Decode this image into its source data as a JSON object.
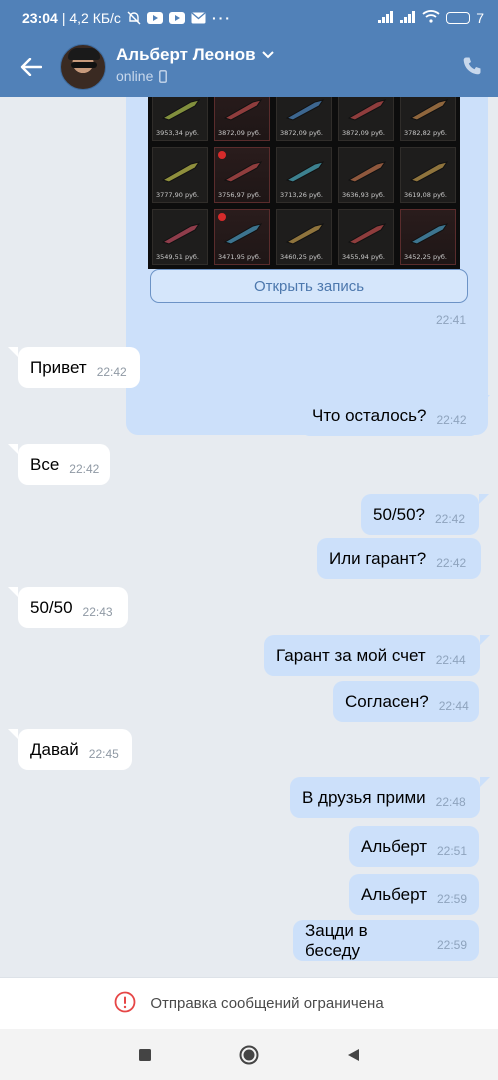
{
  "status_bar": {
    "time": "23:04",
    "net_speed": "| 4,2 КБ/с",
    "battery": "7"
  },
  "header": {
    "contact_name": "Альберт Леонов",
    "status": "online"
  },
  "record": {
    "prices": [
      "3953,34 руб.",
      "3872,09 руб.",
      "3872,09 руб.",
      "3872,09 руб.",
      "3782,82 руб.",
      "3777,90 руб.",
      "3756,97 руб.",
      "3713,26 руб.",
      "3636,93 руб.",
      "3619,08 руб.",
      "3549,51 руб.",
      "3471,95 руб.",
      "3460,25 руб.",
      "3455,94 руб.",
      "3452,25 руб."
    ],
    "open_button": "Открыть запись",
    "time": "22:41"
  },
  "messages": [
    {
      "side": "in",
      "text": "Привет",
      "time": "22:42"
    },
    {
      "side": "out",
      "text": "Что осталось?",
      "time": "22:42"
    },
    {
      "side": "in",
      "text": "Все",
      "time": "22:42"
    },
    {
      "side": "out",
      "text": "50/50?",
      "time": "22:42"
    },
    {
      "side": "out",
      "text": "Или гарант?",
      "time": "22:42"
    },
    {
      "side": "in",
      "text": "50/50",
      "time": "22:43"
    },
    {
      "side": "out",
      "text": "Гарант за мой счет",
      "time": "22:44"
    },
    {
      "side": "out",
      "text": "Согласен?",
      "time": "22:44"
    },
    {
      "side": "in",
      "text": "Давай",
      "time": "22:45"
    },
    {
      "side": "out",
      "text": "В друзья прими",
      "time": "22:48"
    },
    {
      "side": "out",
      "text": "Альберт",
      "time": "22:51"
    },
    {
      "side": "out",
      "text": "Альберт",
      "time": "22:59"
    },
    {
      "side": "out",
      "text": "Зацди в беседу",
      "time": "22:59"
    }
  ],
  "footer": {
    "restricted_text": "Отправка сообщений ограничена"
  },
  "colors": {
    "header": "#5181b8",
    "chat_bg": "#e7ebf0",
    "out_bubble": "#cce0fa",
    "in_bubble": "#ffffff",
    "warning": "#e64646"
  }
}
